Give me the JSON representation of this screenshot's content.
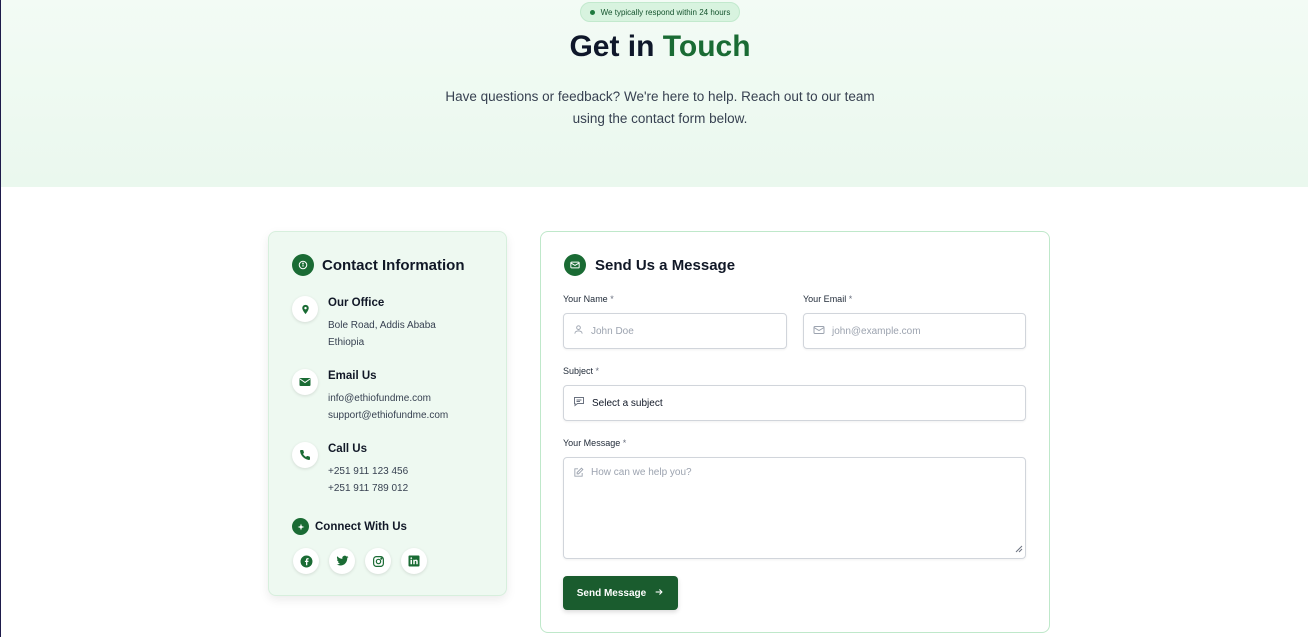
{
  "hero": {
    "badge": "We typically respond within 24 hours",
    "title_start": "Get in",
    "title_accent": "Touch",
    "subtitle": "Have questions or feedback? We're here to help. Reach out to our team using the contact form below."
  },
  "contact_info": {
    "title": "Contact Information",
    "items": [
      {
        "icon": "map-pin-icon",
        "label": "Our Office",
        "lines": [
          "Bole Road, Addis Ababa",
          "Ethiopia"
        ]
      },
      {
        "icon": "mail-icon",
        "label": "Email Us",
        "lines": [
          "info@ethiofundme.com",
          "support@ethiofundme.com"
        ]
      },
      {
        "icon": "phone-icon",
        "label": "Call Us",
        "lines": [
          "+251 911 123 456",
          "+251 911 789 012"
        ]
      }
    ],
    "connect_label": "Connect With Us",
    "socials": [
      "facebook-icon",
      "twitter-icon",
      "instagram-icon",
      "linkedin-icon"
    ]
  },
  "form": {
    "title": "Send Us a Message",
    "name_label": "Your Name",
    "name_placeholder": "John Doe",
    "email_label": "Your Email",
    "email_placeholder": "john@example.com",
    "subject_label": "Subject",
    "subject_value": "Select a subject",
    "message_label": "Your Message",
    "message_placeholder": "How can we help you?",
    "required_mark": "*",
    "submit_label": "Send Message"
  },
  "colors": {
    "brand_green": "#1a6b34",
    "button_green": "#1a5c2e",
    "hero_bg": "#eaf8ee",
    "card_bg": "#eef9f1"
  }
}
